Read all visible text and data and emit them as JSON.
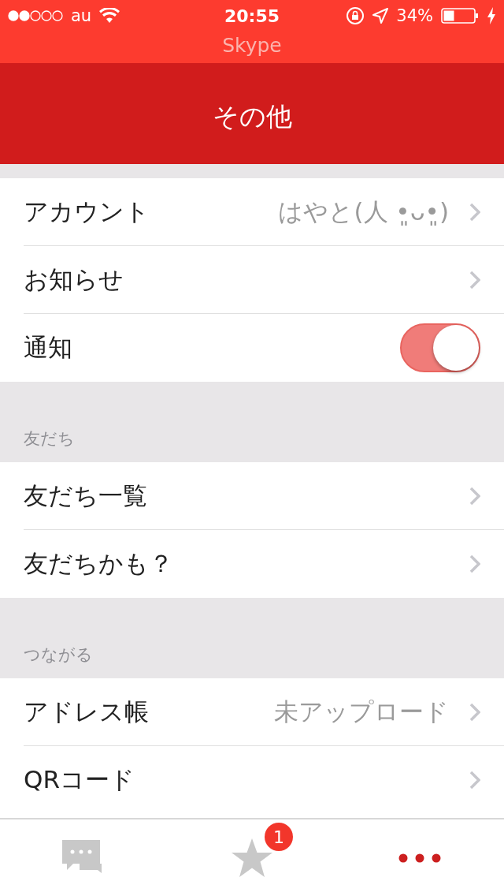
{
  "status_bar": {
    "carrier": "au",
    "time": "20:55",
    "battery": "34%"
  },
  "app_title": "Skype",
  "header": {
    "title": "その他"
  },
  "sections": [
    {
      "rows": [
        {
          "kind": "link",
          "label": "アカウント",
          "value": "はやと(人 •͈ᴗ•͈)"
        },
        {
          "kind": "link",
          "label": "お知らせ"
        },
        {
          "kind": "toggle",
          "label": "通知",
          "on": true
        }
      ]
    },
    {
      "title": "友だち",
      "rows": [
        {
          "kind": "link",
          "label": "友だち一覧"
        },
        {
          "kind": "link",
          "label": "友だちかも？"
        }
      ]
    },
    {
      "title": "つながる",
      "rows": [
        {
          "kind": "link",
          "label": "アドレス帳",
          "value": "未アップロード"
        },
        {
          "kind": "link",
          "label": "QRコード"
        }
      ]
    }
  ],
  "tab_bar": [
    {
      "kind": "chats",
      "selected": false
    },
    {
      "kind": "favorites",
      "selected": false,
      "badge": "1"
    },
    {
      "kind": "more",
      "selected": true
    }
  ]
}
